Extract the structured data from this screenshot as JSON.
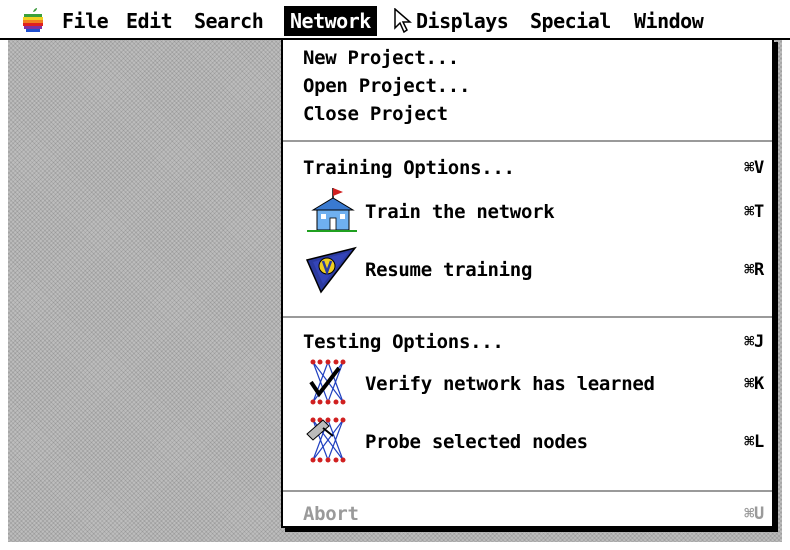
{
  "menubar": {
    "items": [
      {
        "label": "File"
      },
      {
        "label": "Edit"
      },
      {
        "label": "Search"
      },
      {
        "label": "Network"
      },
      {
        "label": "Displays"
      },
      {
        "label": "Special"
      },
      {
        "label": "Window"
      }
    ]
  },
  "network_menu": {
    "items": [
      {
        "label": "New Project...",
        "shortcut": ""
      },
      {
        "label": "Open Project...",
        "shortcut": ""
      },
      {
        "label": "Close Project",
        "shortcut": ""
      },
      {
        "label": "Training Options...",
        "shortcut": "⌘V"
      },
      {
        "label": "Train the network",
        "shortcut": "⌘T",
        "icon": "schoolhouse-icon"
      },
      {
        "label": "Resume training",
        "shortcut": "⌘R",
        "icon": "pennant-icon"
      },
      {
        "label": "Testing Options...",
        "shortcut": "⌘J"
      },
      {
        "label": "Verify network has learned",
        "shortcut": "⌘K",
        "icon": "verify-network-icon"
      },
      {
        "label": "Probe selected nodes",
        "shortcut": "⌘L",
        "icon": "probe-network-icon"
      },
      {
        "label": "Abort",
        "shortcut": "⌘U",
        "disabled": true
      }
    ]
  }
}
